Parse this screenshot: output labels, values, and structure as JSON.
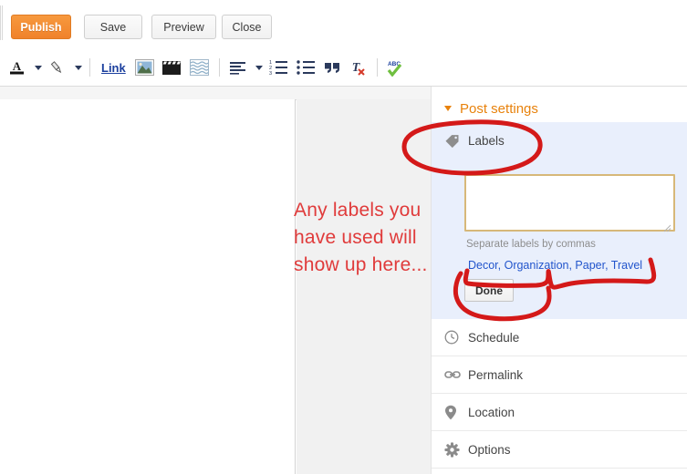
{
  "topbar": {
    "buttons": [
      {
        "label": "Publish",
        "name": "publish-button"
      },
      {
        "label": "Save",
        "name": "save-button"
      },
      {
        "label": "Preview",
        "name": "preview-button"
      },
      {
        "label": "Close",
        "name": "close-button"
      }
    ]
  },
  "toolbar": {
    "items": [
      {
        "name": "text-color-icon",
        "label": "A"
      },
      {
        "name": "text-color-dropdown-icon",
        "label": ""
      },
      {
        "name": "highlight-color-icon",
        "label": ""
      },
      {
        "name": "highlight-color-dropdown-icon",
        "label": ""
      },
      {
        "name": "link-button",
        "label": "Link"
      },
      {
        "name": "insert-image-icon",
        "label": ""
      },
      {
        "name": "insert-video-icon",
        "label": ""
      },
      {
        "name": "insert-jump-break-icon",
        "label": ""
      },
      {
        "name": "align-icon",
        "label": ""
      },
      {
        "name": "align-dropdown-icon",
        "label": ""
      },
      {
        "name": "numbered-list-icon",
        "label": ""
      },
      {
        "name": "bulleted-list-icon",
        "label": ""
      },
      {
        "name": "blockquote-icon",
        "label": ""
      },
      {
        "name": "remove-formatting-icon",
        "label": ""
      },
      {
        "name": "spell-check-icon",
        "label": "ABC"
      }
    ]
  },
  "sidebar": {
    "header": "Post settings",
    "labels": {
      "title": "Labels",
      "textarea_value": "",
      "textarea_placeholder": "",
      "hint": "Separate labels by commas",
      "used_labels": "Decor, Organization, Paper, Travel",
      "done_label": "Done"
    },
    "items": [
      {
        "label": "Schedule",
        "icon": "clock-icon"
      },
      {
        "label": "Permalink",
        "icon": "link-icon"
      },
      {
        "label": "Location",
        "icon": "location-pin-icon"
      },
      {
        "label": "Options",
        "icon": "gear-icon"
      }
    ]
  },
  "annotation": {
    "line1": "Any labels you",
    "line2": "have used will",
    "line3": "show up here...",
    "color": "#e03b3b"
  },
  "colors": {
    "publish_orange": "#f0822b",
    "settings_orange": "#e8820c",
    "labels_panel_blue": "#e9effc",
    "textarea_border": "#d7b879",
    "link_blue": "#2255cc",
    "annotation_red": "#e03b3b"
  }
}
